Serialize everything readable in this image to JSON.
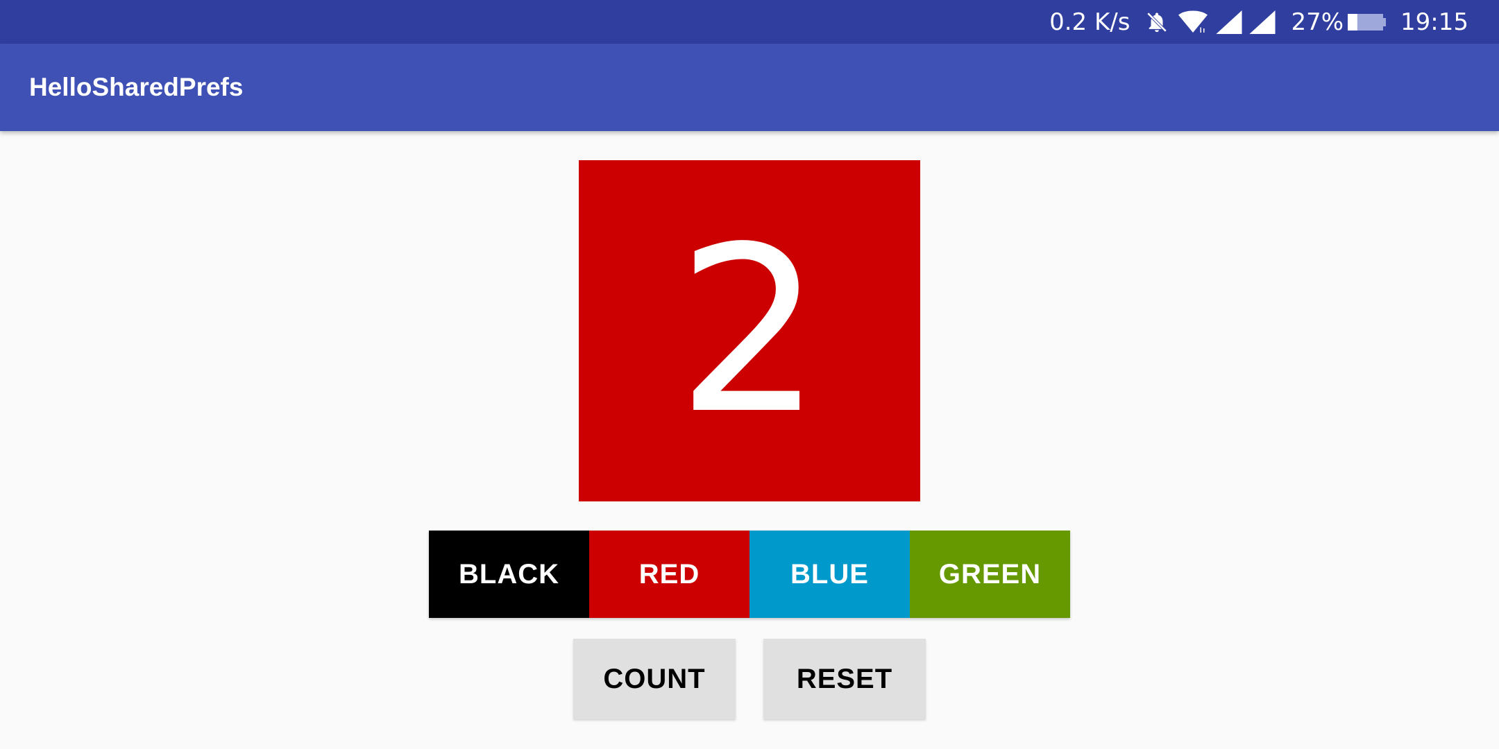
{
  "status_bar": {
    "net_speed": "0.2 K/s",
    "battery_percent": "27%",
    "time": "19:15",
    "icons": [
      "bell-off-icon",
      "wifi-icon",
      "cell-signal-icon",
      "cell-signal-icon",
      "battery-icon"
    ],
    "battery_level": 0.27
  },
  "app_bar": {
    "title": "HelloSharedPrefs"
  },
  "counter": {
    "value": "2",
    "background_color": "#CC0000"
  },
  "color_buttons": [
    {
      "label": "BLACK",
      "color": "#000000"
    },
    {
      "label": "RED",
      "color": "#CC0000"
    },
    {
      "label": "BLUE",
      "color": "#0099CC"
    },
    {
      "label": "GREEN",
      "color": "#669900"
    }
  ],
  "actions": {
    "count_label": "COUNT",
    "reset_label": "RESET"
  },
  "colors": {
    "status_bar": "#303F9F",
    "app_bar": "#3F51B5",
    "background": "#FAFAFA",
    "action_button": "#E0E0E0"
  }
}
